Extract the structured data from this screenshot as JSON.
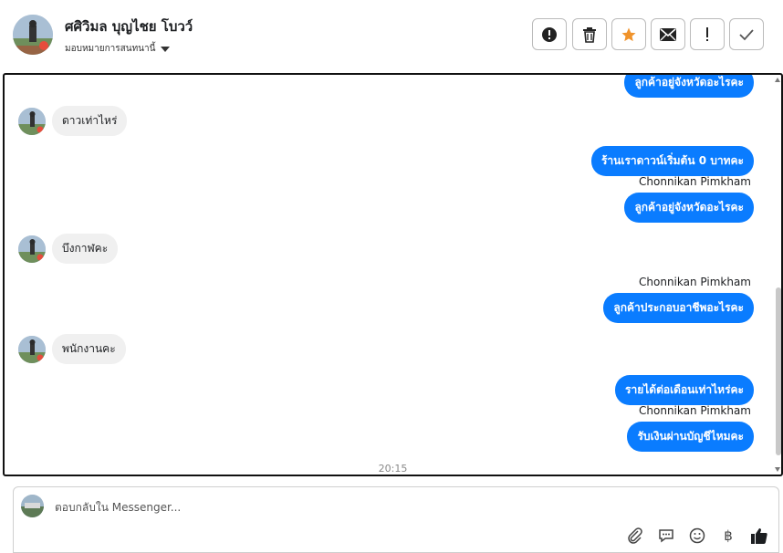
{
  "header": {
    "contact_name": "ศศิวิมล บุญไชย โบวว์",
    "assign_label": "มอบหมายการสนทนานี้",
    "toolbar": [
      "important-icon",
      "trash-icon",
      "star-icon",
      "mail-icon",
      "flag-icon",
      "check-icon"
    ],
    "accent_star": "#f0932b"
  },
  "messages": {
    "m0_out": "ลูกค้าอยู่จังหวัดอะไรคะ",
    "m1_in": "ดาวเท่าไหร่",
    "m2_out": "ร้านเราดาวน์เริ่มต้น 0 บาทคะ",
    "m3_sender": "Chonnikan Pimkham",
    "m3_out": "ลูกค้าอยู่จังหวัดอะไรคะ",
    "m4_in": "บึงกาฬคะ",
    "m5_sender": "Chonnikan Pimkham",
    "m5_out": "ลูกค้าประกอบอาชีพอะไรคะ",
    "m6_in": "พนักงานคะ",
    "m7_out": "รายได้ต่อเดือนเท่าไหร่คะ",
    "m8_sender": "Chonnikan Pimkham",
    "m8_out": "รับเงินผ่านบัญชีไหมคะ",
    "timestamp": "20:15"
  },
  "composer": {
    "placeholder": "ตอบกลับใน Messenger...",
    "currency_symbol": "฿",
    "tools": [
      "attachment-icon",
      "saved-reply-icon",
      "emoji-icon",
      "currency-icon",
      "thumbs-up-icon"
    ]
  },
  "colors": {
    "bubble_out": "#0a7cff",
    "bubble_in": "#f0f0f0"
  }
}
